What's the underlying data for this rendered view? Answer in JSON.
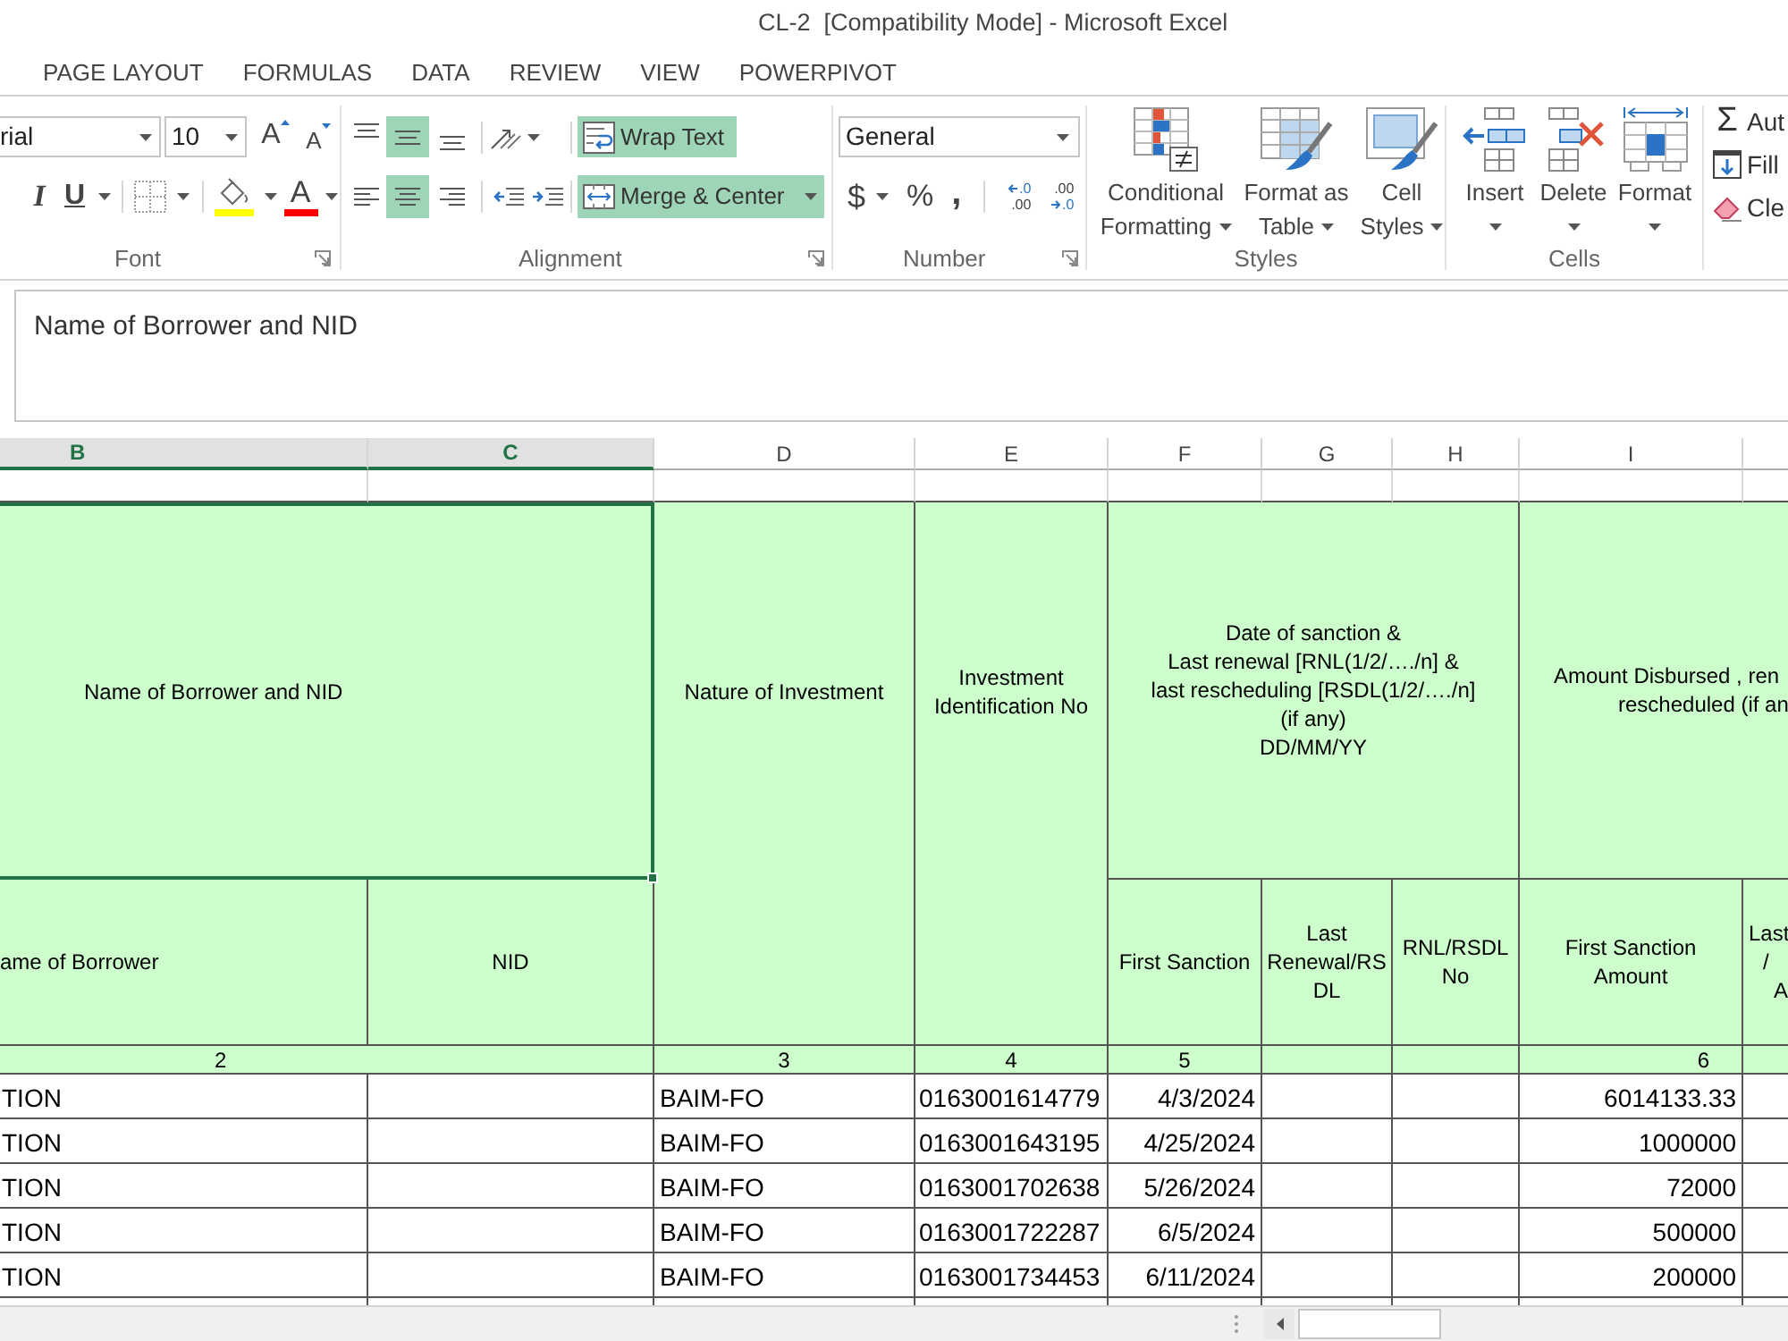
{
  "window": {
    "title": "CL-2  [Compatibility Mode] - Microsoft Excel"
  },
  "ribbon_tabs": [
    {
      "label": "PAGE LAYOUT",
      "selected": false
    },
    {
      "label": "FORMULAS",
      "selected": false
    },
    {
      "label": "DATA",
      "selected": false
    },
    {
      "label": "REVIEW",
      "selected": false
    },
    {
      "label": "VIEW",
      "selected": false
    },
    {
      "label": "POWERPIVOT",
      "selected": false
    }
  ],
  "font_group": {
    "label": "Font",
    "font_name": "rial",
    "font_size": "10",
    "grow_font": "A",
    "shrink_font": "A",
    "italic": "I",
    "underline": "U",
    "font_color": "A"
  },
  "alignment_group": {
    "label": "Alignment",
    "vertical": [
      {
        "kind": "top",
        "on": false
      },
      {
        "kind": "middle",
        "on": true
      },
      {
        "kind": "bottom",
        "on": false
      }
    ],
    "horizontal": [
      {
        "kind": "left",
        "on": false
      },
      {
        "kind": "center",
        "on": true
      },
      {
        "kind": "right",
        "on": false
      }
    ],
    "wrap_text": {
      "label": "Wrap Text",
      "on": true
    },
    "merge_center": {
      "label": "Merge & Center",
      "on": true
    }
  },
  "number_group": {
    "label": "Number",
    "format": "General",
    "currency": "$",
    "percent": "%",
    "comma": ",",
    "increase_decimal": [
      ".0",
      ".00"
    ],
    "decrease_decimal": [
      ".00",
      ".0"
    ]
  },
  "styles_group": {
    "label": "Styles",
    "buttons": [
      {
        "kind": "conditional",
        "lines": [
          "Conditional",
          "Formatting"
        ]
      },
      {
        "kind": "table",
        "lines": [
          "Format as",
          "Table"
        ]
      },
      {
        "kind": "cell_styles",
        "lines": [
          "Cell",
          "Styles"
        ]
      }
    ]
  },
  "cells_group": {
    "label": "Cells",
    "buttons": [
      {
        "kind": "insert",
        "label": "Insert"
      },
      {
        "kind": "delete",
        "label": "Delete"
      },
      {
        "kind": "format",
        "label": "Format"
      }
    ]
  },
  "editing_group": {
    "buttons": [
      {
        "kind": "autosum",
        "symbol": "Σ",
        "label": "Aut"
      },
      {
        "kind": "fill",
        "label": "Fill"
      },
      {
        "kind": "clear",
        "label": "Cle"
      }
    ]
  },
  "formula_bar": {
    "value": "Name of Borrower and NID"
  },
  "column_headers": [
    {
      "label": "B",
      "selected": true
    },
    {
      "label": "C",
      "selected": true
    },
    {
      "label": "D",
      "selected": false
    },
    {
      "label": "E",
      "selected": false
    },
    {
      "label": "F",
      "selected": false
    },
    {
      "label": "G",
      "selected": false
    },
    {
      "label": "H",
      "selected": false
    },
    {
      "label": "I",
      "selected": false
    }
  ],
  "sheet": {
    "header_top": [
      {
        "kind": "borrower",
        "lines": [
          "Name of Borrower and NID"
        ],
        "selected": true
      },
      {
        "kind": "nature",
        "lines": [
          "Nature of Investment"
        ],
        "selected": false
      },
      {
        "kind": "investment_id",
        "lines": [
          "Investment",
          "Identification No"
        ],
        "selected": false
      },
      {
        "kind": "date",
        "lines": [
          "Date of sanction &",
          "Last renewal [RNL(1/2/…./n] &",
          "last rescheduling [RSDL(1/2/…./n]",
          "(if any)",
          "DD/MM/YY"
        ],
        "selected": false
      },
      {
        "kind": "amount",
        "lines": [
          "Amount Disbursed , ren",
          "rescheduled (if an"
        ],
        "selected": false
      }
    ],
    "header_sub": [
      {
        "kind": "borrower_name",
        "lines": [
          "ame of Borrower"
        ],
        "selected": false
      },
      {
        "kind": "nid",
        "lines": [
          "NID"
        ],
        "selected": false
      },
      {
        "kind": "first_sanction",
        "lines": [
          "First Sanction"
        ],
        "selected": false
      },
      {
        "kind": "last_renewal",
        "lines": [
          "Last",
          "Renewal/RS",
          "DL"
        ],
        "selected": false
      },
      {
        "kind": "rnl_no",
        "lines": [
          "RNL/RSDL",
          "No"
        ],
        "selected": false
      },
      {
        "kind": "first_amount",
        "lines": [
          "First Sanction",
          "Amount"
        ],
        "selected": false
      },
      {
        "kind": "column_10",
        "lines": [
          "Last",
          "/",
          "A"
        ],
        "selected": false
      }
    ],
    "column_numbers": [
      {
        "kind": "borrower",
        "label": "2"
      },
      {
        "kind": "nature",
        "label": "3"
      },
      {
        "kind": "investment_id",
        "label": "4"
      },
      {
        "kind": "date",
        "label": "5"
      },
      {
        "kind": "amount",
        "label": "6"
      }
    ],
    "rows": [
      {
        "column_b": "TION",
        "nature": "BAIM-FO",
        "investment_id": "0163001614779",
        "first_sanction": "4/3/2024",
        "first_sanction_amount": "6014133.33"
      },
      {
        "column_b": "TION",
        "nature": "BAIM-FO",
        "investment_id": "0163001643195",
        "first_sanction": "4/25/2024",
        "first_sanction_amount": "1000000"
      },
      {
        "column_b": "TION",
        "nature": "BAIM-FO",
        "investment_id": "0163001702638",
        "first_sanction": "5/26/2024",
        "first_sanction_amount": "72000"
      },
      {
        "column_b": "TION",
        "nature": "BAIM-FO",
        "investment_id": "0163001722287",
        "first_sanction": "6/5/2024",
        "first_sanction_amount": "500000"
      },
      {
        "column_b": "TION",
        "nature": "BAIM-FO",
        "investment_id": "0163001734453",
        "first_sanction": "6/11/2024",
        "first_sanction_amount": "200000"
      }
    ]
  }
}
